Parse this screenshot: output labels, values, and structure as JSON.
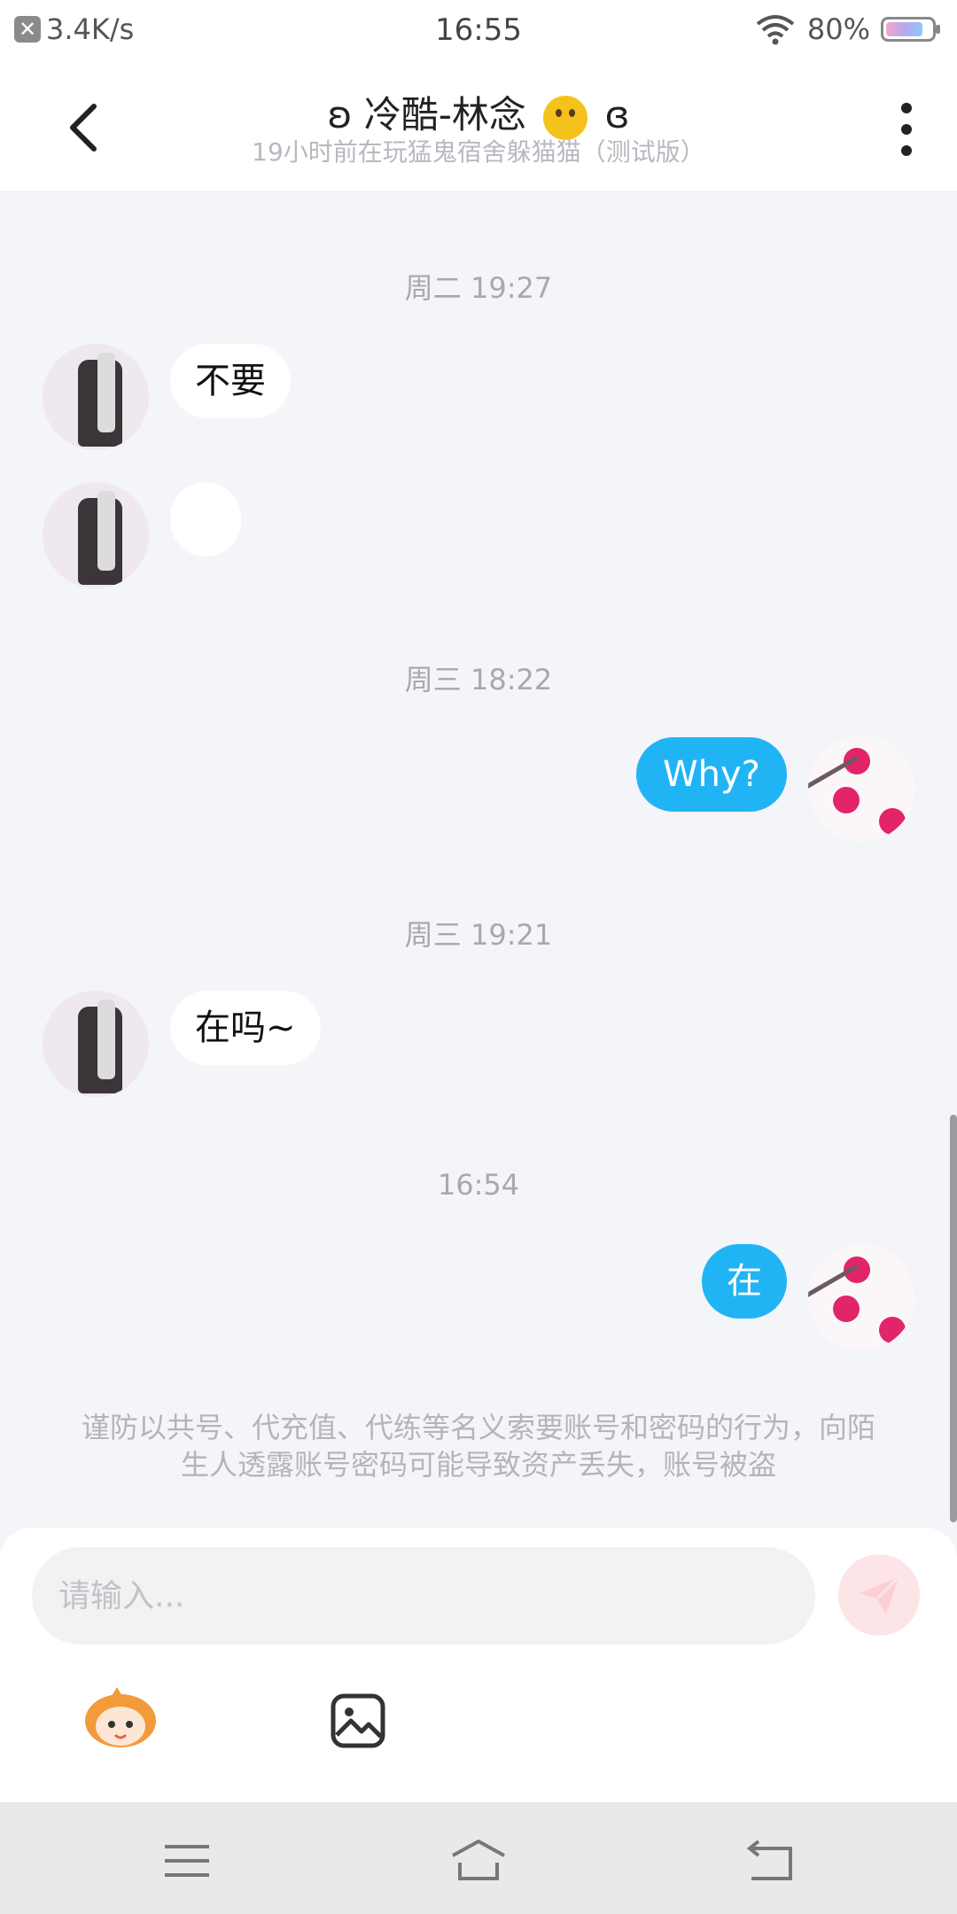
{
  "status_bar": {
    "speed": "3.4K/s",
    "time": "16:55",
    "battery": "80%"
  },
  "header": {
    "title_left": "ʚ 冷酷-林念",
    "title_right": "ɞ",
    "subtitle": "19小时前在玩猛鬼宿舍躲猫猫（测试版）"
  },
  "messages": {
    "t1": "周二 19:27",
    "m1": "不要",
    "m2": "",
    "t2": "周三 18:22",
    "m3": "Why?",
    "t3": "周三 19:21",
    "m4": "在吗~",
    "t4": "16:54",
    "m5": "在"
  },
  "notice": "谨防以共号、代充值、代练等名义索要账号和密码的行为，向陌生人透露账号密码可能导致资产丢失，账号被盗",
  "composer": {
    "placeholder": "请输入..."
  },
  "colors": {
    "accent": "#21b4f5",
    "send_bg": "#fde4e6"
  }
}
